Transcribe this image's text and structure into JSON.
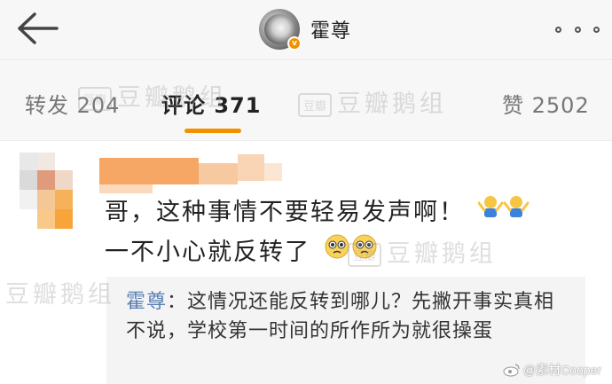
{
  "header": {
    "username": "霍尊",
    "verified_badge": "v",
    "back_icon": "arrow-left-icon",
    "more_icon": "more-dots-icon"
  },
  "tabs": {
    "repost_label": "转发",
    "repost_count": "204",
    "comment_label": "评论",
    "comment_count": "371",
    "like_label": "赞",
    "like_count": "2502"
  },
  "watermark": {
    "badge": "豆瓣",
    "text": "豆瓣鹅组"
  },
  "comment": {
    "line1": "哥，这种事情不要轻易发声啊！",
    "line2": "一不小心就反转了",
    "reply": {
      "name": "霍尊",
      "text": "：这情况还能反转到哪儿？先撇开事实真相不说，学校第一时间的所作所为就很操蛋"
    }
  },
  "footer": {
    "credit": "@素材Cooper"
  },
  "colors": {
    "accent": "#f29100",
    "reply_name": "#5a7fb5",
    "header_bg": "#f7f7f7"
  }
}
